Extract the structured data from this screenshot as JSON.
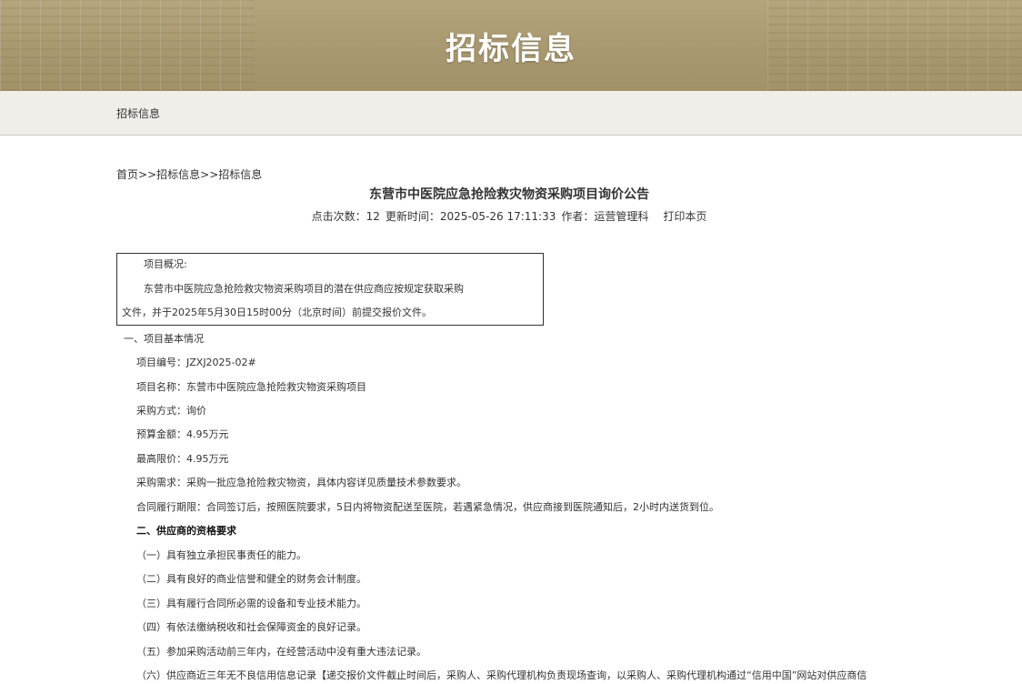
{
  "banner": {
    "title": "招标信息"
  },
  "subnav": {
    "label": "招标信息"
  },
  "breadcrumb": {
    "home": "首页",
    "sep1": ">>",
    "level1": "招标信息",
    "sep2": ">>",
    "level2": "招标信息"
  },
  "article": {
    "title": "东营市中医院应急抢险救灾物资采购项目询价公告",
    "meta": {
      "clicks_label": "点击次数：",
      "clicks_value": "12",
      "updated_label": "更新时间：",
      "updated_value": "2025-05-26 17:11:33",
      "author_label": "作者：",
      "author_value": "运营管理科",
      "print_label": "打印本页"
    },
    "overview": {
      "heading": "项目概况:",
      "line2": "东营市中医院应急抢险救灾物资采购项目的潜在供应商应按规定获取采购",
      "line3": "文件，并于2025年5月30日15时00分（北京时间）前提交报价文件。"
    },
    "section1": {
      "heading": "一、项目基本情况",
      "items": [
        "项目编号：JZXJ2025-02#",
        "项目名称：东营市中医院应急抢险救灾物资采购项目",
        "采购方式：询价",
        "预算金额：4.95万元",
        "最高限价：4.95万元",
        "采购需求：采购一批应急抢险救灾物资，具体内容详见质量技术参数要求。",
        "合同履行期限：合同签订后，按照医院要求，5日内将物资配送至医院，若遇紧急情况，供应商接到医院通知后，2小时内送货到位。"
      ]
    },
    "section2": {
      "heading": "二、供应商的资格要求",
      "items": [
        "（一）具有独立承担民事责任的能力。",
        "（二）具有良好的商业信誉和健全的财务会计制度。",
        "（三）具有履行合同所必需的设备和专业技术能力。",
        "（四）有依法缴纳税收和社会保障资金的良好记录。",
        "（五）参加采购活动前三年内，在经营活动中没有重大违法记录。",
        "（六）供应商近三年无不良信用信息记录【递交报价文件截止时间后，采购人、采购代理机构负责现场查询，以采购人、采购代理机构通过“信用中国”网站对供应商信"
      ]
    }
  }
}
